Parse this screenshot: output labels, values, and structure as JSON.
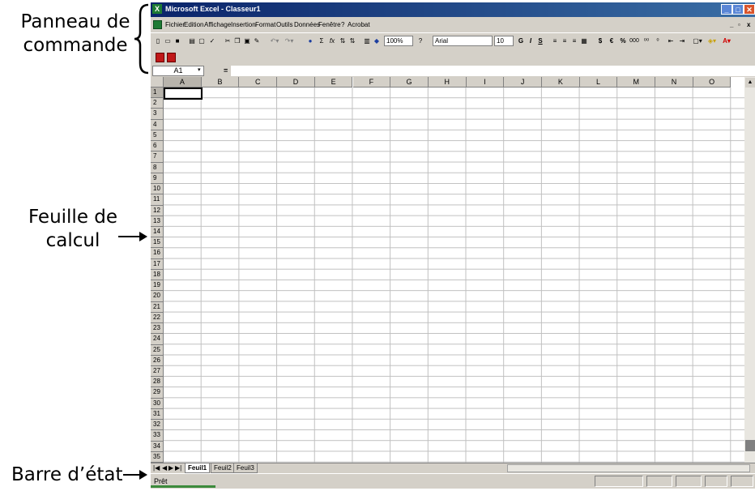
{
  "annotations": {
    "panel_line1": "Panneau de",
    "panel_line2": "commande",
    "sheet_line1": "Feuille de",
    "sheet_line2": "calcul",
    "status_label": "Barre d’état"
  },
  "window": {
    "title": "Microsoft Excel - Classeur1",
    "app_icon": "excel-icon",
    "min_glyph": "_",
    "max_glyph": "□",
    "close_glyph": "✕"
  },
  "menu": {
    "items": [
      "Fichier",
      "Edition",
      "Affichage",
      "Insertion",
      "Format",
      "Outils",
      "Données",
      "Fenêtre",
      "?",
      "Acrobat"
    ]
  },
  "toolbar": {
    "zoom": "100%",
    "font": "Arial",
    "font_size": "10",
    "bold": "G",
    "italic": "I",
    "underline": "S",
    "currency": "$",
    "euro": "€",
    "percent": "%",
    "thousands": "000",
    "sigma": "Σ",
    "fx": "fx",
    "help": "?"
  },
  "formula_bar": {
    "name_box": "A1",
    "equals": "="
  },
  "grid": {
    "columns": [
      "A",
      "B",
      "C",
      "D",
      "E",
      "F",
      "G",
      "H",
      "I",
      "J",
      "K",
      "L",
      "M",
      "N",
      "O"
    ],
    "rows": [
      "1",
      "2",
      "3",
      "4",
      "5",
      "6",
      "7",
      "8",
      "9",
      "10",
      "11",
      "12",
      "13",
      "14",
      "15",
      "16",
      "17",
      "18",
      "19",
      "20",
      "21",
      "22",
      "23",
      "24",
      "25",
      "26",
      "27",
      "28",
      "29",
      "30",
      "31",
      "32",
      "33",
      "34",
      "35"
    ],
    "active_cell": "A1"
  },
  "sheets": {
    "tabs": [
      "Feuil1",
      "Feuil2",
      "Feuil3"
    ],
    "active": "Feuil1"
  },
  "status_bar": {
    "text": "Prêt"
  },
  "colors": {
    "title_start": "#0a246a",
    "title_end": "#3a6ea5",
    "chrome": "#d4d0c8"
  }
}
